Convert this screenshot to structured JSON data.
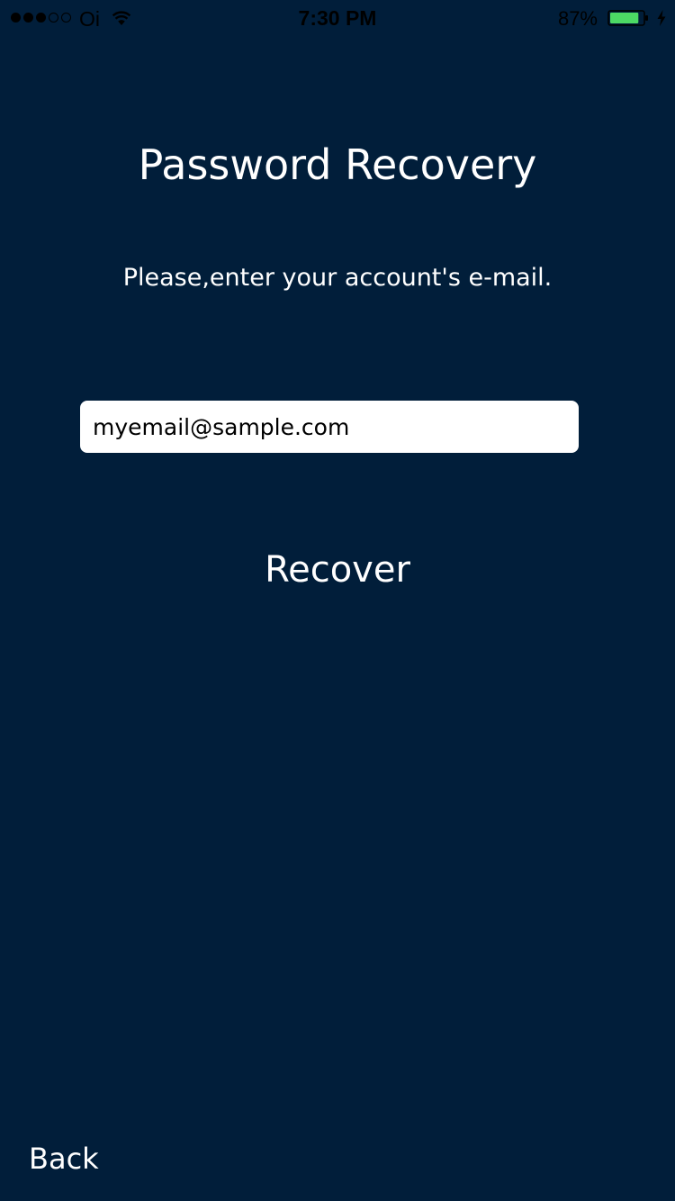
{
  "status_bar": {
    "carrier": "Oi",
    "time": "7:30 PM",
    "battery_percent": "87%",
    "battery_level": 0.87,
    "signal_bars_filled": 3,
    "signal_bars_total": 5,
    "wifi_icon": "wifi-icon",
    "charging_icon": "charging-bolt-icon",
    "battery_color": "#4cd964"
  },
  "screen": {
    "title": "Password Recovery",
    "instruction": "Please,enter your account's e-mail.",
    "email_value": "myemail@sample.com",
    "recover_label": "Recover",
    "back_label": "Back",
    "background_color": "#011e3a"
  }
}
